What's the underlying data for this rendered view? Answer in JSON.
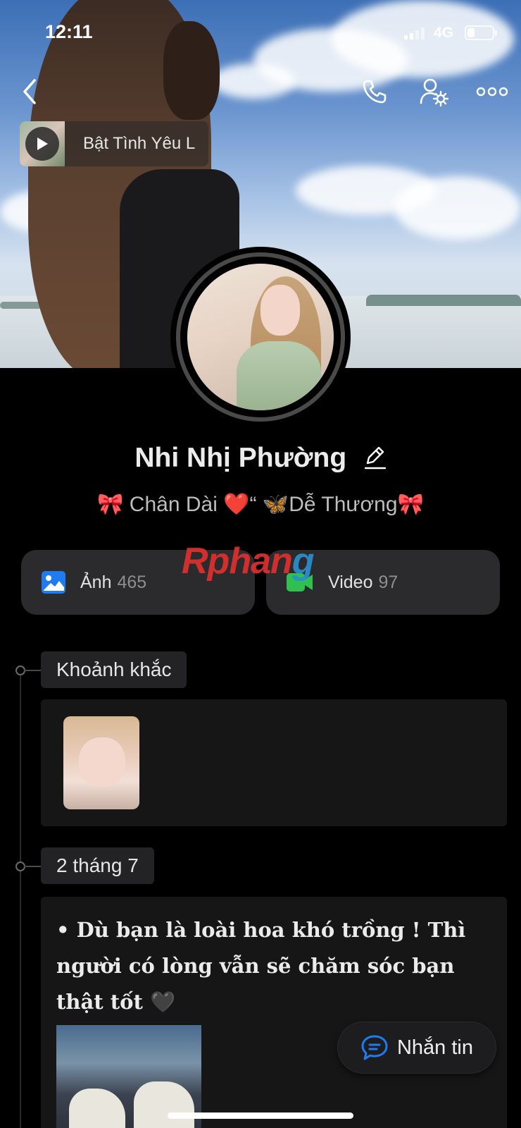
{
  "status_bar": {
    "time": "12:11",
    "network": "4G",
    "battery_level": 0.3
  },
  "header": {
    "icons": [
      "chevron-left-icon",
      "phone-icon",
      "friend-settings-icon",
      "more-icon"
    ]
  },
  "music": {
    "title": "Bật Tình Yêu L",
    "icon": "play-icon"
  },
  "profile": {
    "name": "Nhi Nhị Phường",
    "bio": "🎀  Chân Dài ❤️“ 🦋Dễ Thương🎀"
  },
  "watermark": {
    "part1": "Rphan",
    "part2": "g"
  },
  "media": {
    "photos": {
      "label": "Ảnh",
      "count": "465",
      "icon": "image-icon",
      "color": "#1f7cf0"
    },
    "videos": {
      "label": "Video",
      "count": "97",
      "icon": "video-camera-icon",
      "color": "#30c04f"
    }
  },
  "timeline": {
    "moments_label": "Khoảnh khắc",
    "post_date": "2 tháng 7",
    "post_text": "• Dù bạn là loài hoa khó trồng ! Thì người có lòng vẫn sẽ chăm sóc bạn thật tốt 🖤"
  },
  "message_button": {
    "label": "Nhắn tin",
    "icon": "chat-bubble-icon",
    "color": "#1f7cf0"
  }
}
